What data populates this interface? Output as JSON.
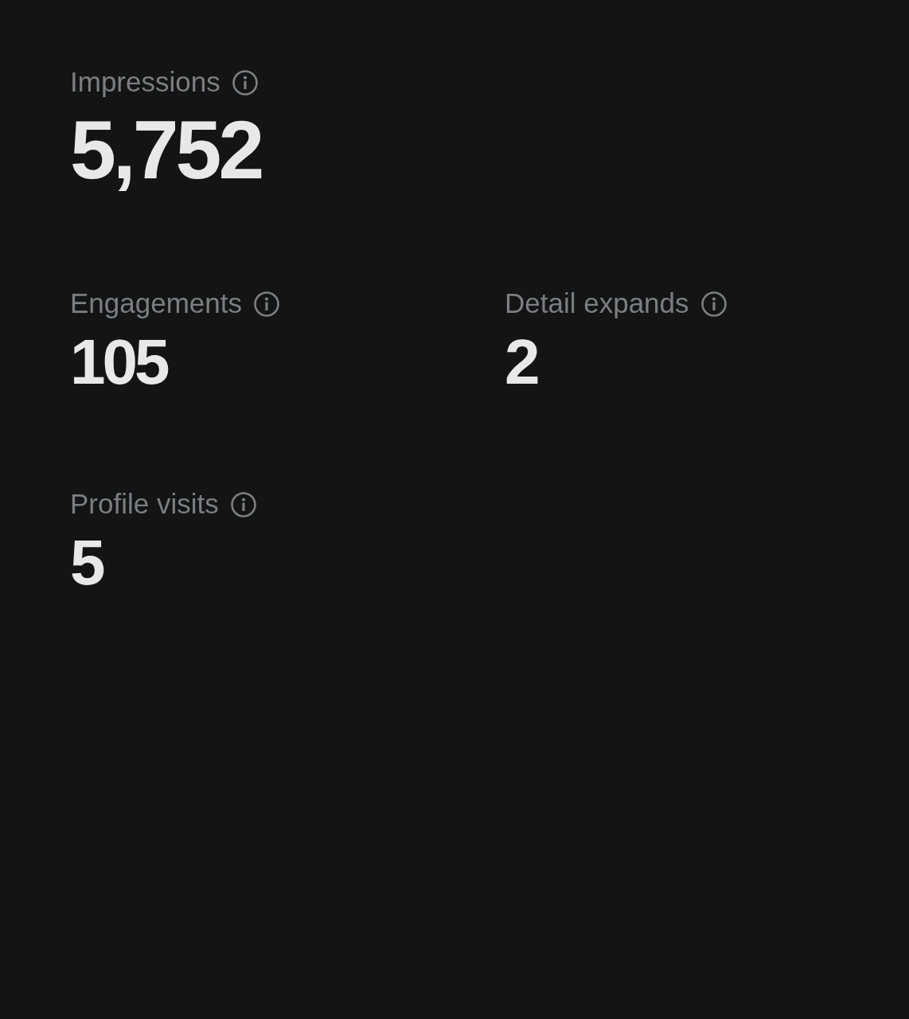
{
  "hero": {
    "label": "Impressions",
    "value": "5,752"
  },
  "metrics": [
    {
      "label": "Engagements",
      "value": "105"
    },
    {
      "label": "Detail expands",
      "value": "2"
    },
    {
      "label": "Profile visits",
      "value": "5"
    }
  ]
}
